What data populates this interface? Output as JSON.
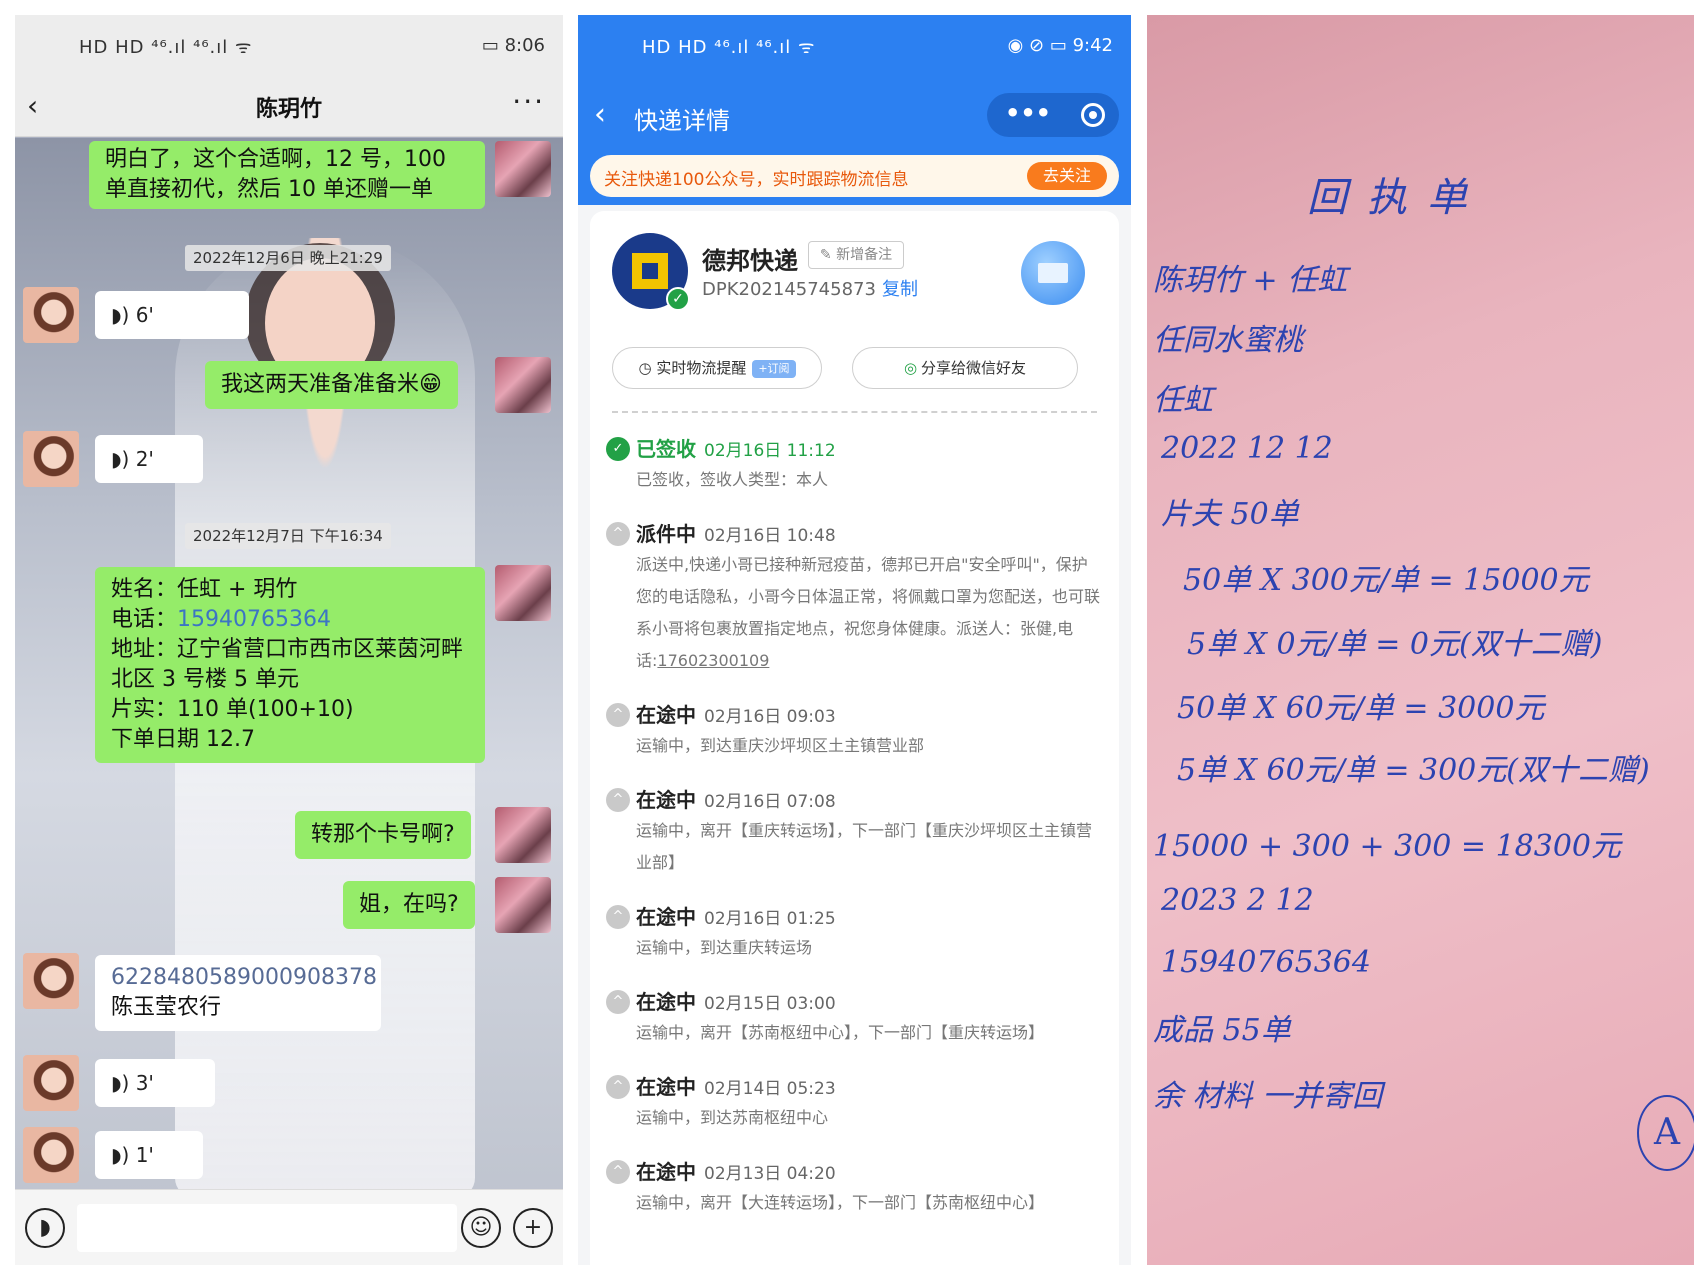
{
  "chat": {
    "status_time": "8:06",
    "status_left": "HD HD ⁴⁶.ıl ⁴⁶.ıl ᯤ",
    "contact": "陈玥竹",
    "msg_top": "明白了，这个合适啊，12 号，100 单直接初代，然后 10 单还赠一单",
    "ts1": "2022年12月6日 晚上21:29",
    "voice1": "6'",
    "msg_ready": "我这两天准备准备米😁",
    "voice2": "2'",
    "ts2": "2022年12月7日 下午16:34",
    "order": {
      "name": "姓名：任虹 + 玥竹",
      "phone_label": "电话：",
      "phone": "15940765364",
      "address": "地址：辽宁省营口市西市区莱茵河畔北区 3 号楼 5 单元",
      "qty": "片实：110 单(100+10)",
      "date": "下单日期 12.7"
    },
    "msg_card": "转那个卡号啊?",
    "msg_ask": "姐，在吗?",
    "card_number": "6228480589000908378",
    "card_bank": "陈玉莹农行",
    "voice3": "3'",
    "voice4": "1'"
  },
  "express": {
    "status_time": "9:42",
    "status_left": "HD HD ⁴⁶.ıl ⁴⁶.ıl ᯤ",
    "title": "快递详情",
    "banner_text": "关注快递100公众号，实时跟踪物流信息",
    "banner_btn": "去关注",
    "carrier": "德邦快递",
    "note_tag": "✎ 新增备注",
    "tracking_no": "DPK202145745873",
    "copy": "复制",
    "remind_btn": "实时物流提醒",
    "remind_badge": "+订阅",
    "share_btn": "分享给微信好友",
    "events": [
      {
        "status": "已签收",
        "time": "02月16日 11:12",
        "desc": "已签收，签收人类型：本人"
      },
      {
        "status": "派件中",
        "time": "02月16日 10:48",
        "desc": "派送中,快递小哥已接种新冠疫苗，德邦已开启\"安全呼叫\"，保护您的电话隐私，小哥今日体温正常，将佩戴口罩为您配送，也可联系小哥将包裹放置指定地点，祝您身体健康。派送人：张健,电话:",
        "phone": "17602300109"
      },
      {
        "status": "在途中",
        "time": "02月16日 09:03",
        "desc": "运输中，到达重庆沙坪坝区土主镇营业部"
      },
      {
        "status": "在途中",
        "time": "02月16日 07:08",
        "desc": "运输中，离开【重庆转运场】，下一部门【重庆沙坪坝区土主镇营业部】"
      },
      {
        "status": "在途中",
        "time": "02月16日 01:25",
        "desc": "运输中，到达重庆转运场"
      },
      {
        "status": "在途中",
        "time": "02月15日 03:00",
        "desc": "运输中，离开【苏南枢纽中心】，下一部门【重庆转运场】"
      },
      {
        "status": "在途中",
        "time": "02月14日 05:23",
        "desc": "运输中，到达苏南枢纽中心"
      },
      {
        "status": "在途中",
        "time": "02月13日 04:20",
        "desc": "运输中，离开【大连转运场】，下一部门【苏南枢纽中心】"
      }
    ]
  },
  "receipt": {
    "title": "回执单",
    "lines": [
      "陈玥竹 + 任虹",
      "任同水蜜桃",
      "任虹",
      "2022 12 12",
      "片夫 50单",
      "50单 X 300元/单 = 15000元",
      "5单 X 0元/单 = 0元(双十二赠)",
      "50单 X 60元/单 = 3000元",
      "5单 X 60元/单 = 300元(双十二赠)",
      "15000 + 300 + 300 = 18300元",
      "2023 2 12",
      "15940765364",
      "成品 55单",
      "余 材料 一并寄回"
    ],
    "stamp": "A"
  }
}
